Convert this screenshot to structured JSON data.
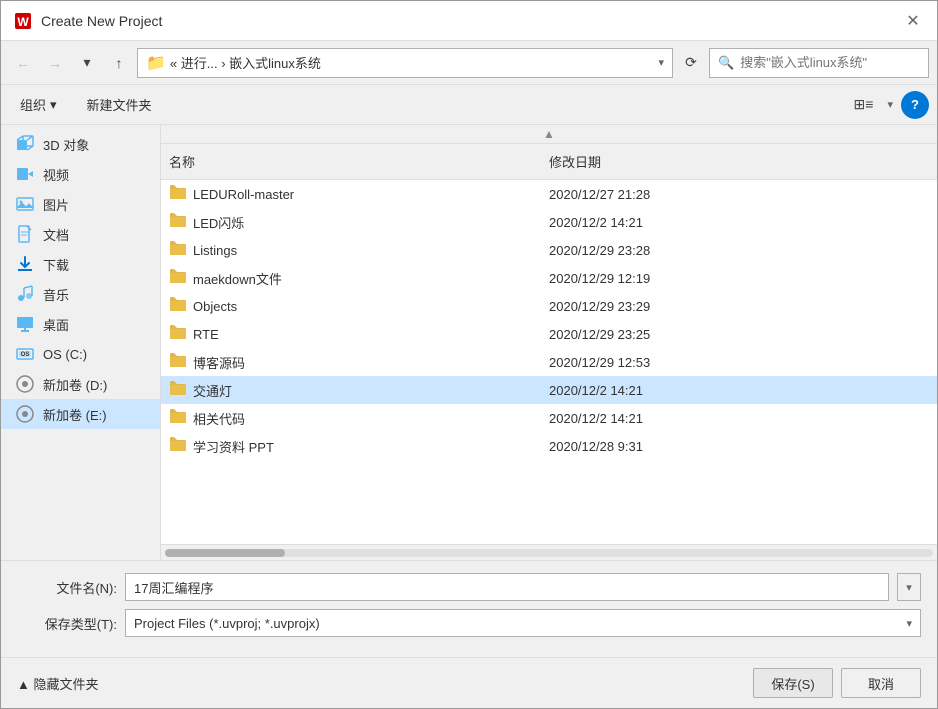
{
  "title_bar": {
    "title": "Create New Project",
    "icon": "▣",
    "close_label": "✕"
  },
  "address_bar": {
    "back_label": "←",
    "forward_label": "→",
    "dropdown_label": "▾",
    "up_label": "↑",
    "path_display": "« 进行... › 嵌入式linux系统",
    "refresh_label": "⟳",
    "search_placeholder": "搜索\"嵌入式linux系统\""
  },
  "toolbar": {
    "organize_label": "组织",
    "new_folder_label": "新建文件夹",
    "view_label": "⊞",
    "help_label": "?"
  },
  "sidebar": {
    "items": [
      {
        "id": "3d",
        "icon": "🔷",
        "label": "3D 对象"
      },
      {
        "id": "video",
        "icon": "🎬",
        "label": "视频"
      },
      {
        "id": "photo",
        "icon": "🖼",
        "label": "图片"
      },
      {
        "id": "docs",
        "icon": "📄",
        "label": "文档"
      },
      {
        "id": "download",
        "icon": "⬇",
        "label": "下载"
      },
      {
        "id": "music",
        "icon": "🎵",
        "label": "音乐"
      },
      {
        "id": "desktop",
        "icon": "🖥",
        "label": "桌面"
      },
      {
        "id": "c_drive",
        "icon": "💾",
        "label": "OS (C:)"
      },
      {
        "id": "d_drive",
        "icon": "💿",
        "label": "新加卷 (D:)"
      },
      {
        "id": "e_drive",
        "icon": "💿",
        "label": "新加卷 (E:)"
      }
    ]
  },
  "file_list": {
    "columns": [
      {
        "id": "name",
        "label": "名称"
      },
      {
        "id": "date",
        "label": "修改日期"
      }
    ],
    "files": [
      {
        "name": "LEDURoll-master",
        "date": "2020/12/27 21:28",
        "selected": false
      },
      {
        "name": "LED闪烁",
        "date": "2020/12/2 14:21",
        "selected": false
      },
      {
        "name": "Listings",
        "date": "2020/12/29 23:28",
        "selected": false
      },
      {
        "name": "maekdown文件",
        "date": "2020/12/29 12:19",
        "selected": false
      },
      {
        "name": "Objects",
        "date": "2020/12/29 23:29",
        "selected": false
      },
      {
        "name": "RTE",
        "date": "2020/12/29 23:25",
        "selected": false
      },
      {
        "name": "博客源码",
        "date": "2020/12/29 12:53",
        "selected": false
      },
      {
        "name": "交通灯",
        "date": "2020/12/2 14:21",
        "selected": true
      },
      {
        "name": "相关代码",
        "date": "2020/12/2 14:21",
        "selected": false
      },
      {
        "name": "学习资料  PPT",
        "date": "2020/12/28 9:31",
        "selected": false
      }
    ]
  },
  "bottom": {
    "filename_label": "文件名(N):",
    "filename_value": "17周汇编程序",
    "filetype_label": "保存类型(T):",
    "filetype_value": "Project Files (*.uvproj; *.uvprojx)"
  },
  "action_bar": {
    "hide_folders_label": "▲ 隐藏文件夹",
    "save_label": "保存(S)",
    "cancel_label": "取消"
  }
}
